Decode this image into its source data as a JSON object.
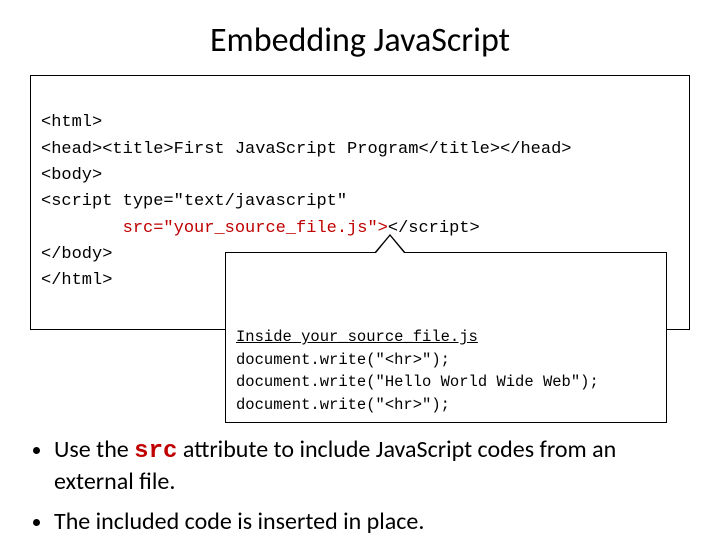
{
  "title": "Embedding JavaScript",
  "code": {
    "l1": "<html>",
    "l2": "<head><title>First JavaScript Program</title></head>",
    "l3": "<body>",
    "l4": "<script type=\"text/javascript\"",
    "l5_indent": "        ",
    "l5_src": "src=\"your_source_file.js\">",
    "l5_close": "</script>",
    "l6": "</body>",
    "l7": "</html>"
  },
  "callout": {
    "heading": "Inside your_source_file.js",
    "c1": "document.write(\"<hr>\");",
    "c2": "document.write(\"Hello World Wide Web\");",
    "c3": "document.write(\"<hr>\");"
  },
  "bullets": {
    "b1_pre": "Use the ",
    "b1_src": "src",
    "b1_post": " attribute to include JavaScript codes from an external file.",
    "b2": "The included code is inserted in place."
  }
}
